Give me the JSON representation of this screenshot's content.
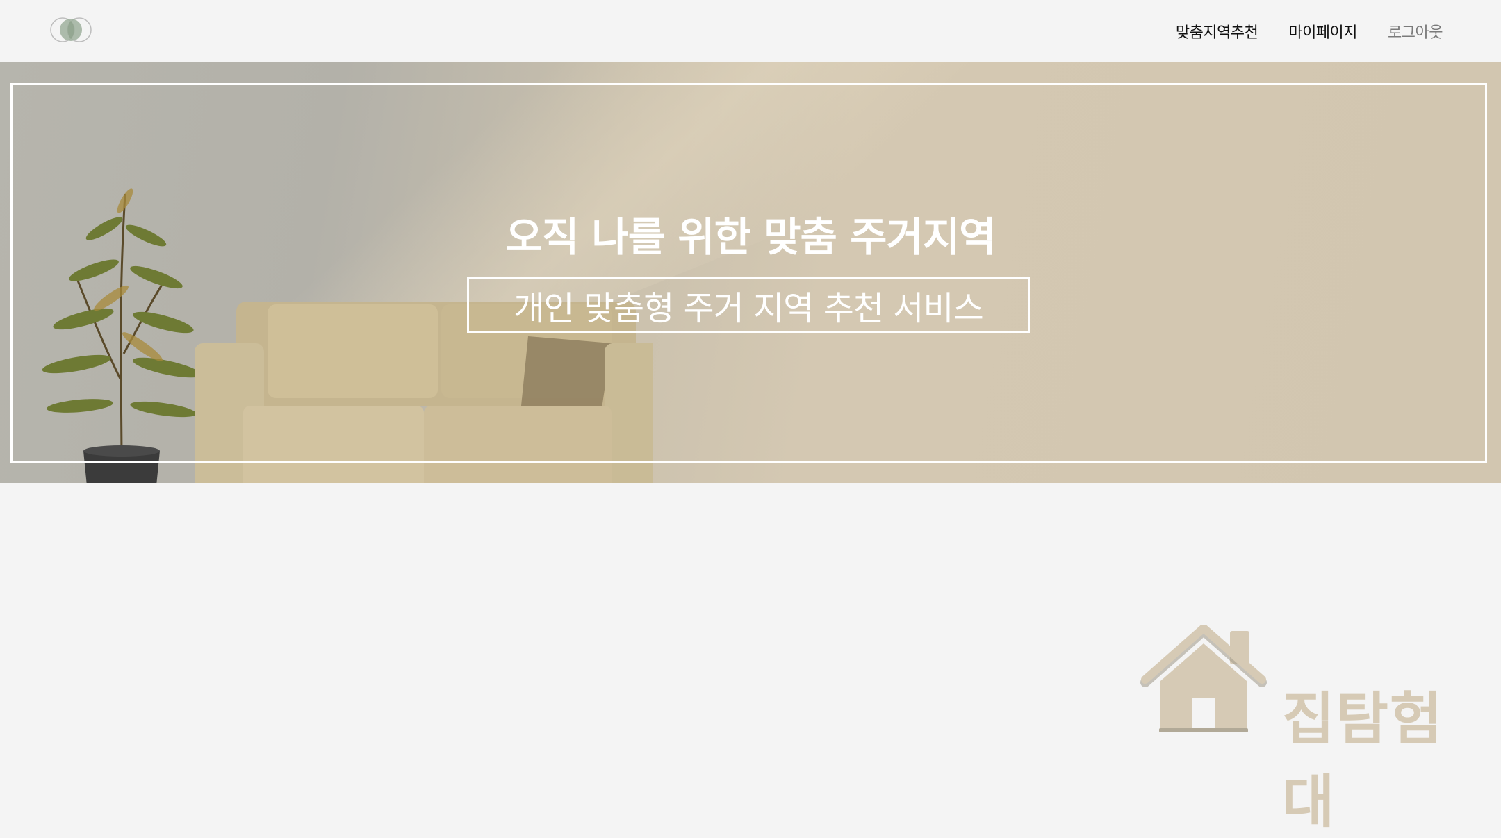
{
  "nav": {
    "items": [
      {
        "label": "맞춤지역추천"
      },
      {
        "label": "마이페이지"
      },
      {
        "label": "로그아웃"
      }
    ]
  },
  "hero": {
    "title": "오직 나를 위한 맞춤 주거지역",
    "subtitle": "개인 맞춤형 주거  지역 추천 서비스"
  },
  "brand": {
    "name": "집탐험대"
  },
  "icons": {
    "logo": "overlapping-circles-logo-icon",
    "brand": "house-icon"
  },
  "colors": {
    "background": "#f4f4f4",
    "hero_beige": "#d2c6b0",
    "brand_beige": "#d6cab5",
    "logo_green": "#9fb09d"
  }
}
